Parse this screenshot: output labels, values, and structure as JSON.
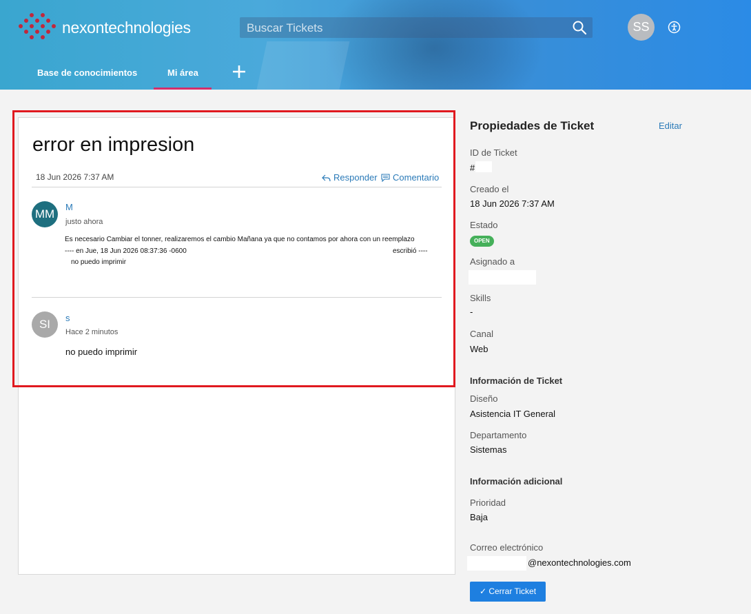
{
  "header": {
    "brand": "nexontechnologies",
    "search_placeholder": "Buscar Tickets",
    "user_initials": "SS",
    "nav": {
      "knowledge_base": "Base de conocimientos",
      "my_area": "Mi área"
    },
    "colors": {
      "accent_underline": "#d62e6a",
      "logo_dots": "#c0283c"
    }
  },
  "ticket": {
    "title": "error en impresion",
    "created": "18 Jun 2026 7:37 AM",
    "reply_label": "Responder",
    "comment_label": "Comentario",
    "messages": [
      {
        "initials": "MM",
        "author": "M",
        "time": "justo ahora",
        "lines": [
          "Es necesario Cambiar el tonner, realizaremos el cambio Mañana ya que no contamos por ahora con un reemplazo",
          "---- en Jue, 18 Jun 2026 08:37:36 -0600",
          "escribió ----",
          "no puedo imprimir"
        ]
      },
      {
        "initials": "SI",
        "author": "s",
        "time": "Hace 2 minutos",
        "body": "no puedo imprimir"
      }
    ]
  },
  "properties": {
    "title": "Propiedades de Ticket",
    "edit": "Editar",
    "ticket_id_label": "ID de Ticket",
    "ticket_id_value": "#",
    "created_label": "Creado el",
    "created_value": "18 Jun 2026 7:37 AM",
    "status_label": "Estado",
    "status_value": "OPEN",
    "assigned_label": "Asignado a",
    "skills_label": "Skills",
    "skills_value": "-",
    "channel_label": "Canal",
    "channel_value": "Web",
    "ticket_info_section": "Información de Ticket",
    "design_label": "Diseño",
    "design_value": "Asistencia IT General",
    "department_label": "Departamento",
    "department_value": "Sistemas",
    "additional_section": "Información adicional",
    "priority_label": "Prioridad",
    "priority_value": "Baja",
    "email_label": "Correo electrónico",
    "email_value": "@nexontechnologies.com",
    "close_button": "Cerrar Ticket",
    "status_color": "#45b05a"
  }
}
